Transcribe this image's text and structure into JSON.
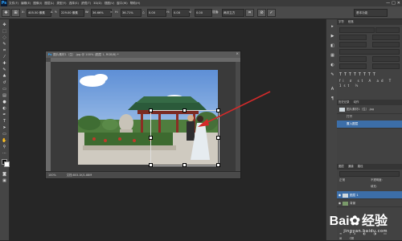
{
  "app": {
    "logo": "Ps",
    "menu": [
      "文件(F)",
      "编辑(E)",
      "图像(I)",
      "图层(L)",
      "类型(Y)",
      "选择(S)",
      "滤镜(T)",
      "3D(D)",
      "视图(V)",
      "窗口(W)",
      "帮助(H)"
    ],
    "window_controls": [
      "—",
      "□",
      "✕"
    ]
  },
  "options": {
    "x_label": "X:",
    "x_value": "405.50 像素",
    "y_label": "Y:",
    "y_value": "229.00 像素",
    "w_label": "W:",
    "w_value": "36.66%",
    "h_label": "H:",
    "h_value": "36.71%",
    "angle_value": "0.00",
    "h_skew_label": "H:",
    "h_skew_value": "0.00",
    "v_skew_label": "V:",
    "v_skew_value": "0.00",
    "interp": "两次立方",
    "workspace": "基本功能"
  },
  "document": {
    "title": "图片素材1（生）.jpg @ 100% (图层 1, RGB/8) *",
    "zoom": "100%",
    "status": "文档:803.1K/1.88M",
    "ps_badge": "Ps",
    "close": "×"
  },
  "panels": {
    "char_tabs": [
      "字符",
      "段落"
    ],
    "history_tabs": [
      "历史记录",
      "动作"
    ],
    "history_items": [
      {
        "label": "图片素材1（生）.jpg",
        "selected": false
      },
      {
        "label": "打开",
        "selected": false
      },
      {
        "label": "置入图层",
        "selected": true
      }
    ],
    "layers_tabs": [
      "图层",
      "通道",
      "路径"
    ],
    "blend_mode": "正常",
    "opacity_label": "不透明度:",
    "fill_label": "填充:",
    "layers": [
      {
        "name": "图层 1",
        "selected": true
      },
      {
        "name": "背景",
        "selected": false
      }
    ]
  },
  "watermark": {
    "brand": "Bai",
    "brand2": "经验",
    "url": "jingyan.baidu.com"
  },
  "colors": {
    "accent": "#2fa6ff",
    "arrow": "#d32a2a",
    "selection": "#3c6ea8"
  }
}
